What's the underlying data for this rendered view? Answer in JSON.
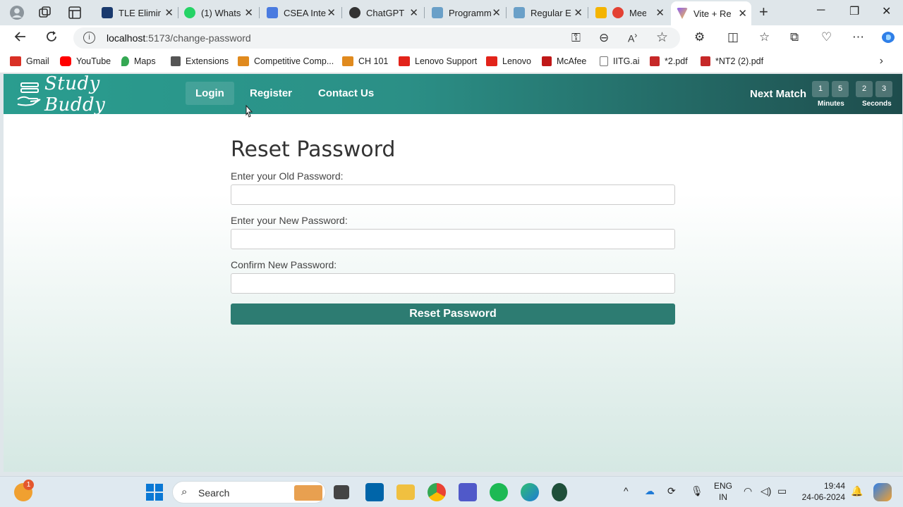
{
  "browser": {
    "tabs": [
      {
        "title": "TLE Elimin",
        "color": "#1a3a6e"
      },
      {
        "title": "(1) Whats",
        "color": "#25d366"
      },
      {
        "title": "CSEA Inte",
        "color": "#4a7be0"
      },
      {
        "title": "ChatGPT",
        "color": "#333333"
      },
      {
        "title": "Programm",
        "color": "#6aa0c8"
      },
      {
        "title": "Regular E",
        "color": "#6aa0c8"
      },
      {
        "title": "Meet",
        "color": "#e34133"
      },
      {
        "title": "Vite + Re",
        "color": "#8a5cf6"
      }
    ],
    "url_host": "localhost",
    "url_path": ":5173/change-password",
    "bookmarks": [
      {
        "label": "Gmail",
        "color": "#d93025"
      },
      {
        "label": "YouTube",
        "color": "#ff0000"
      },
      {
        "label": "Maps",
        "color": "#34a853"
      },
      {
        "label": "Extensions",
        "color": "#555555"
      },
      {
        "label": "Competitive Comp...",
        "color": "#e08a1e"
      },
      {
        "label": "CH 101",
        "color": "#e08a1e"
      },
      {
        "label": "Lenovo Support",
        "color": "#e2231a"
      },
      {
        "label": "Lenovo",
        "color": "#e2231a"
      },
      {
        "label": "McAfee",
        "color": "#c01818"
      },
      {
        "label": "IITG.ai",
        "color": "#777777"
      },
      {
        "label": "*2.pdf",
        "color": "#c62828"
      },
      {
        "label": "*NT2 (2).pdf",
        "color": "#c62828"
      }
    ]
  },
  "site": {
    "logo_text": "Study Buddy",
    "nav": {
      "login": "Login",
      "register": "Register",
      "contact": "Contact Us"
    },
    "next_match": {
      "label": "Next Match",
      "minutes": [
        "1",
        "5"
      ],
      "seconds": [
        "2",
        "3"
      ],
      "minutes_label": "Minutes",
      "seconds_label": "Seconds"
    },
    "form": {
      "title": "Reset Password",
      "old_label": "Enter your Old Password:",
      "new_label": "Enter your New Password:",
      "confirm_label": "Confirm New Password:",
      "submit": "Reset Password"
    },
    "colors": {
      "header_start": "#2a9d8f",
      "header_end": "#1e4c4c",
      "button": "#2d7c72"
    }
  },
  "taskbar": {
    "search": "Search",
    "notification_count": "1",
    "lang_line1": "ENG",
    "lang_line2": "IN",
    "time": "19:44",
    "date": "24-06-2024"
  }
}
